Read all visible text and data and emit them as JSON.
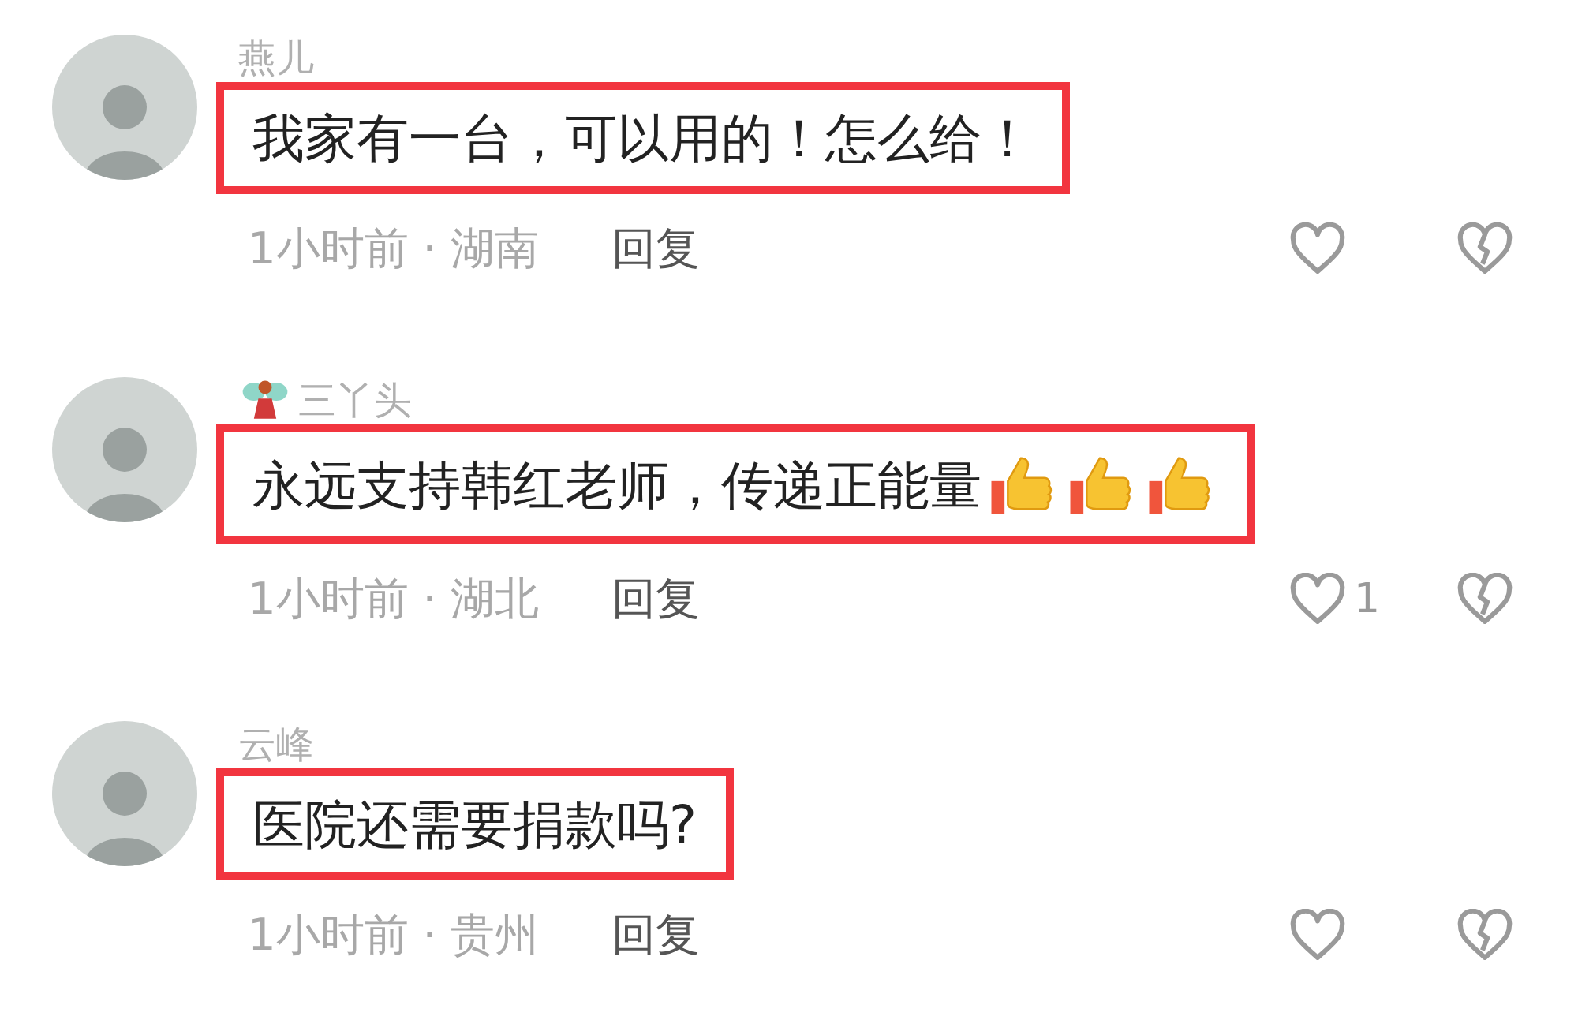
{
  "comments": [
    {
      "author": "燕儿",
      "text": "我家有一台，可以用的！怎么给！",
      "meta": "1小时前 · 湖南",
      "reply": "回复"
    },
    {
      "author": "三丫头",
      "name_icons": [
        {
          "kind": "fairy"
        }
      ],
      "text": "永远支持韩红老师，传递正能量",
      "emoji": [
        {
          "kind": "thumbs-up"
        },
        {
          "kind": "thumbs-up"
        },
        {
          "kind": "thumbs-up"
        }
      ],
      "meta": "1小时前 · 湖北",
      "reply": "回复",
      "likes": "1"
    },
    {
      "author": "云峰",
      "text": "医院还需要捐款吗?",
      "meta": "1小时前 · 贵州",
      "reply": "回复"
    }
  ]
}
